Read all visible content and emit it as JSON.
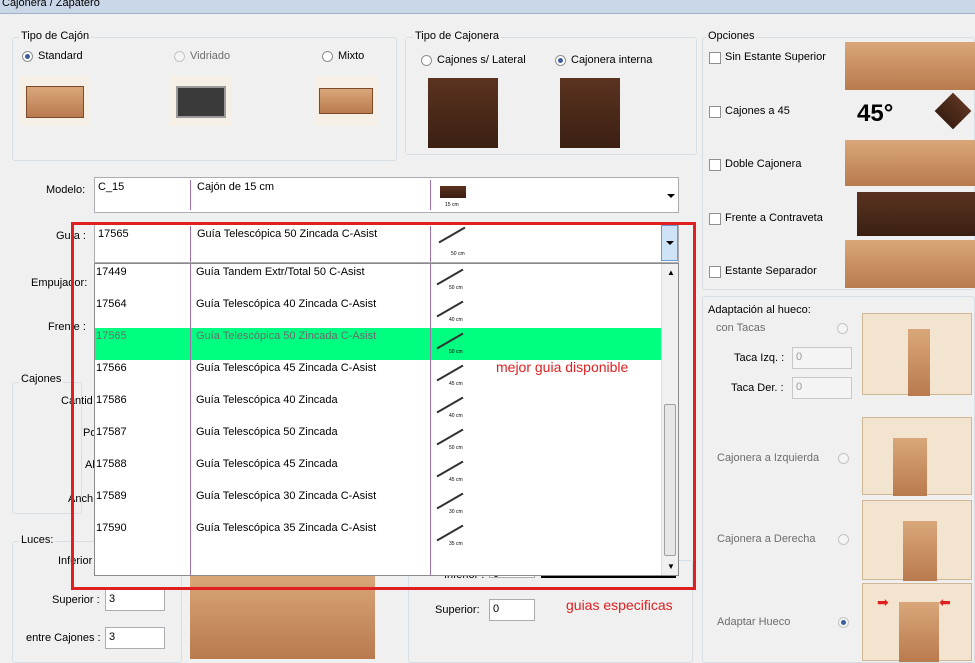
{
  "window": {
    "title": "Cajonera / Zapatero"
  },
  "tipo_cajon": {
    "label": "Tipo de Cajón",
    "options": [
      {
        "label": "Standard",
        "checked": true,
        "enabled": true
      },
      {
        "label": "Vidriado",
        "checked": false,
        "enabled": false
      },
      {
        "label": "Mixto",
        "checked": false,
        "enabled": true
      }
    ]
  },
  "tipo_cajonera": {
    "label": "Tipo de Cajonera",
    "options": [
      {
        "label": "Cajones s/ Lateral",
        "checked": false
      },
      {
        "label": "Cajonera interna",
        "checked": true
      }
    ]
  },
  "opciones": {
    "label": "Opciones",
    "items": [
      {
        "label": "Sin Estante Superior",
        "checked": false
      },
      {
        "label": "Cajones a 45",
        "checked": false
      },
      {
        "label": "Doble Cajonera",
        "checked": false
      },
      {
        "label": "Frente a Contraveta",
        "checked": false
      },
      {
        "label": "Estante Separador",
        "checked": false
      }
    ],
    "angle_label": "45°"
  },
  "form": {
    "modelo_label": "Modelo:",
    "modelo": {
      "code": "C_15",
      "desc": "Cajón de 15 cm",
      "thumb_caption": "15 cm"
    },
    "guia_label": "Guía :",
    "guia": {
      "code": "17565",
      "desc": "Guía Telescópica 50 Zincada C-Asist",
      "thumb_caption": "50 cm"
    },
    "empujador_label": "Empujador:",
    "frente_label": "Frente :"
  },
  "guia_list": [
    {
      "code": "17449",
      "desc": "Guía Tandem Extr/Total 50 C-Asist",
      "caption": "50 cm",
      "selected": false
    },
    {
      "code": "17564",
      "desc": "Guía Telescópica 40 Zincada C-Asist",
      "caption": "40 cm",
      "selected": false
    },
    {
      "code": "17565",
      "desc": "Guía Telescópica 50 Zincada C-Asist",
      "caption": "50 cm",
      "selected": true
    },
    {
      "code": "17566",
      "desc": "Guía Telescópica 45 Zincada C-Asist",
      "caption": "45 cm",
      "selected": false
    },
    {
      "code": "17586",
      "desc": "Guía Telescópica 40 Zincada",
      "caption": "40 cm",
      "selected": false
    },
    {
      "code": "17587",
      "desc": "Guía Telescópica 50 Zincada",
      "caption": "50 cm",
      "selected": false
    },
    {
      "code": "17588",
      "desc": "Guía Telescópica 45 Zincada",
      "caption": "45 cm",
      "selected": false
    },
    {
      "code": "17589",
      "desc": "Guía Telescópica 30 Zincada C-Asist",
      "caption": "30 cm",
      "selected": false
    },
    {
      "code": "17590",
      "desc": "Guía Telescópica 35 Zincada C-Asist",
      "caption": "35 cm",
      "selected": false
    }
  ],
  "cajones": {
    "label": "Cajones",
    "cantidad_label": "Cantid",
    "p_label": "Po",
    "a_label": "Al",
    "ancho_label": "Anch"
  },
  "luces": {
    "label": "Luces:",
    "inferior_label": "Inferior",
    "superior_label": "Superior :",
    "superior_value": "3",
    "entre_label": "entre Cajones :",
    "entre_value": "3"
  },
  "mid_fields": {
    "inferior_label": "Inferior :",
    "inferior_value": "0",
    "superior_label": "Superior:",
    "superior_value": "0"
  },
  "adaptacion": {
    "label": "Adaptación al hueco:",
    "con_tacas": "con Tacas",
    "taca_izq_label": "Taca Izq. :",
    "taca_izq_value": "0",
    "taca_der_label": "Taca Der. :",
    "taca_der_value": "0",
    "izquierda": "Cajonera a Izquierda",
    "derecha": "Cajonera a Derecha",
    "adaptar": "Adaptar Hueco"
  },
  "annotations": {
    "best": "mejor guia disponible",
    "specific": "guias especificas"
  },
  "colors": {
    "highlight": "#00ff80",
    "annotation": "#e02020"
  }
}
